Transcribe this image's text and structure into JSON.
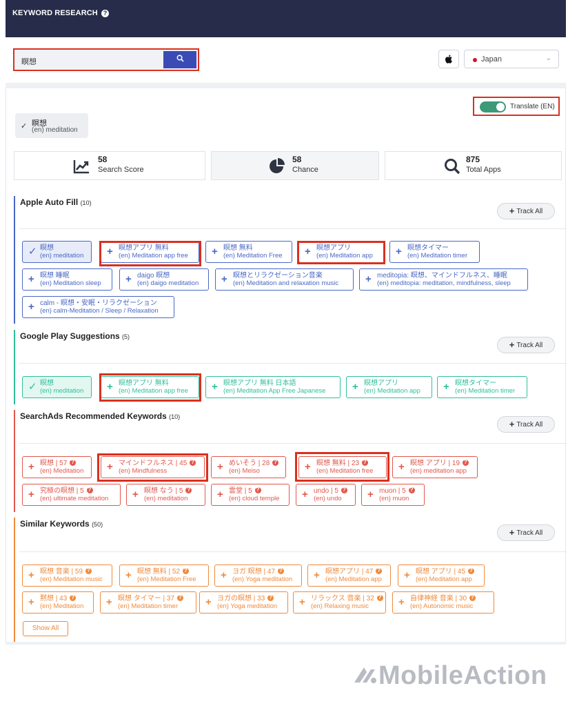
{
  "header": {
    "title": "KEYWORD RESEARCH",
    "help_icon": "?"
  },
  "search": {
    "value": "瞑想",
    "button_icon": "search-icon"
  },
  "platform_icon": "apple-icon",
  "country": {
    "label": "Japan",
    "flag_color": "#d1122a"
  },
  "translate": {
    "label": "Translate (EN)",
    "on": true
  },
  "selected_keyword": {
    "jp": "瞑想",
    "en": "(en) meditation"
  },
  "stats": [
    {
      "value": "58",
      "label": "Search Score",
      "icon": "trend-chart-icon"
    },
    {
      "value": "58",
      "label": "Chance",
      "icon": "pie-chart-icon"
    },
    {
      "value": "875",
      "label": "Total Apps",
      "icon": "search-icon"
    }
  ],
  "track_all_label": "Track All",
  "sections": [
    {
      "title": "Apple Auto Fill",
      "count": "(10)",
      "color": "#4a67c5",
      "chips": [
        {
          "jp": "瞑想",
          "en": "(en) meditation",
          "selected": true
        },
        {
          "jp": "瞑想アプリ 無料",
          "en": "(en) Meditation app free"
        },
        {
          "jp": "瞑想 無料",
          "en": "(en) Meditation Free"
        },
        {
          "jp": "瞑想アプリ",
          "en": "(en) Meditation app"
        },
        {
          "jp": "瞑想タイマー",
          "en": "(en) Meditation timer"
        },
        {
          "jp": "瞑想 睡眠",
          "en": "(en) Meditation sleep"
        },
        {
          "jp": "daigo 瞑想",
          "en": "(en) daigo meditation"
        },
        {
          "jp": "瞑想とリラクゼーション音楽",
          "en": "(en) Meditation and relaxation music"
        },
        {
          "jp": "meditopia: 瞑想、マインドフルネス、睡眠",
          "en": "(en) meditopia: meditation, mindfulness, sleep"
        },
        {
          "jp": "calm - 瞑想・安眠・リラクゼーション",
          "en": "(en) calm-Meditation / Sleep / Relaxation"
        }
      ]
    },
    {
      "title": "Google Play Suggestions",
      "count": "(5)",
      "color": "#2fbf9a",
      "chips": [
        {
          "jp": "瞑想",
          "en": "(en) meditation",
          "selected": true
        },
        {
          "jp": "瞑想アプリ 無料",
          "en": "(en) Meditation app free"
        },
        {
          "jp": "瞑想アプリ 無料 日本語",
          "en": "(en) Meditation App Free Japanese"
        },
        {
          "jp": "瞑想アプリ",
          "en": "(en) Meditation app"
        },
        {
          "jp": "瞑想タイマー",
          "en": "(en) Meditation timer"
        }
      ]
    },
    {
      "title": "SearchAds Recommended Keywords",
      "count": "(10)",
      "color": "#e2574c",
      "chips": [
        {
          "jp": "瞑想 | 57",
          "en": "(en) Meditation"
        },
        {
          "jp": "マインドフルネス | 45",
          "en": "(en) Mindfulness"
        },
        {
          "jp": "めいそう | 28",
          "en": "(en) Meiso"
        },
        {
          "jp": "瞑想 無料 | 23",
          "en": "(en) Meditation free"
        },
        {
          "jp": "瞑想 アプリ | 19",
          "en": "(en) meditation app"
        },
        {
          "jp": "究極の瞑想 | 5",
          "en": "(en) ultimate meditation"
        },
        {
          "jp": "瞑想 なう | 5",
          "en": "(en) meditation"
        },
        {
          "jp": "雲堂 | 5",
          "en": "(en) cloud temple"
        },
        {
          "jp": "undo | 5",
          "en": "(en) undo"
        },
        {
          "jp": "muon | 5",
          "en": "(en) muon"
        }
      ]
    },
    {
      "title": "Similar Keywords",
      "count": "(50)",
      "color": "#ef8a3b",
      "chips": [
        {
          "jp": "瞑想 音楽 | 59",
          "en": "(en) Meditation music"
        },
        {
          "jp": "瞑想 無料 | 52",
          "en": "(en) Meditation Free"
        },
        {
          "jp": "ヨガ 瞑想 | 47",
          "en": "(en) Yoga meditation"
        },
        {
          "jp": "瞑想アプリ | 47",
          "en": "(en) Meditation app"
        },
        {
          "jp": "瞑想 アプリ | 45",
          "en": "(en) Meditation app"
        },
        {
          "jp": "黙想 | 43",
          "en": "(en) Meditation"
        },
        {
          "jp": "瞑想 タイマー | 37",
          "en": "(en) Meditation timer"
        },
        {
          "jp": "ヨガの瞑想 | 33",
          "en": "(en) Yoga meditation"
        },
        {
          "jp": "リラックス 音楽 | 32",
          "en": "(en) Relaxing music"
        },
        {
          "jp": "自律神経 音楽 | 30",
          "en": "(en) Autonomic music"
        }
      ]
    }
  ],
  "show_all_label": "Show All",
  "brand": "MobileAction"
}
